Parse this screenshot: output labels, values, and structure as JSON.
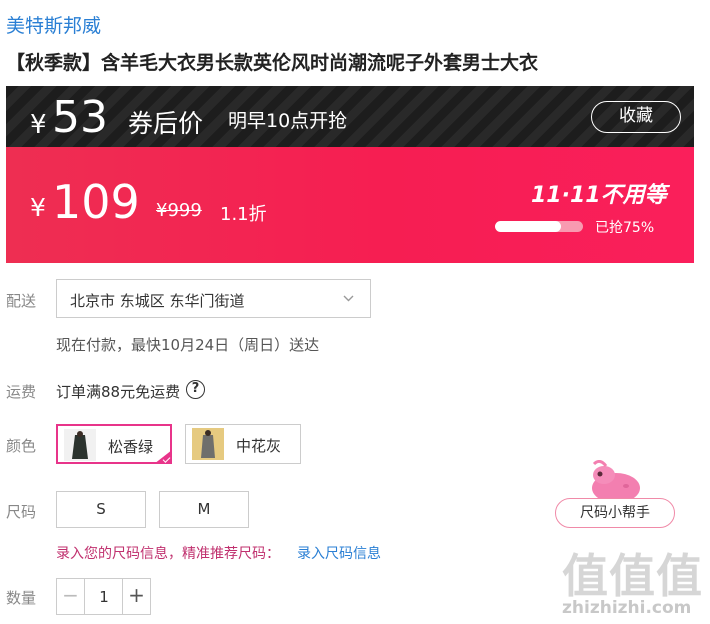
{
  "shop_name": "美特斯邦威",
  "product_title": "【秋季款】含羊毛大衣男长款英伦风时尚潮流呢子外套男士大衣",
  "coupon": {
    "currency": "¥",
    "price": "53",
    "label": "券后价",
    "time_text": "明早10点开抢",
    "favorite_label": "收藏"
  },
  "price": {
    "currency": "¥",
    "current": "109",
    "original": "¥999",
    "discount": "1.1折",
    "promo_num": "11·11",
    "promo_text": "不用等",
    "progress_text": "已抢75%",
    "progress": 0.75
  },
  "shipping": {
    "label": "配送",
    "address": "北京市 东城区 东华门街道",
    "delivery_info": "现在付款，最快10月24日（周日）送达"
  },
  "freight": {
    "label": "运费",
    "text": "订单满88元免运费",
    "help_icon_text": "?"
  },
  "color": {
    "label": "颜色",
    "options": [
      {
        "name": "松香绿",
        "selected": true,
        "icon": "dark-green-coat-thumbnail"
      },
      {
        "name": "中花灰",
        "selected": false,
        "icon": "grey-coat-thumbnail"
      }
    ]
  },
  "size": {
    "label": "尺码",
    "options": [
      "S",
      "M"
    ],
    "hint": "录入您的尺码信息，精准推荐尺码：",
    "hint_link": "录入尺码信息",
    "helper_label": "尺码小帮手"
  },
  "quantity": {
    "label": "数量",
    "value": "1",
    "minus": "−",
    "plus": "+"
  },
  "watermark": {
    "logo": "值值值",
    "site": "zhizhizhi.com"
  },
  "colors": {
    "accent_pink": "#e8348a",
    "price_red": "#f61e52",
    "link_blue": "#2a7fd4"
  }
}
